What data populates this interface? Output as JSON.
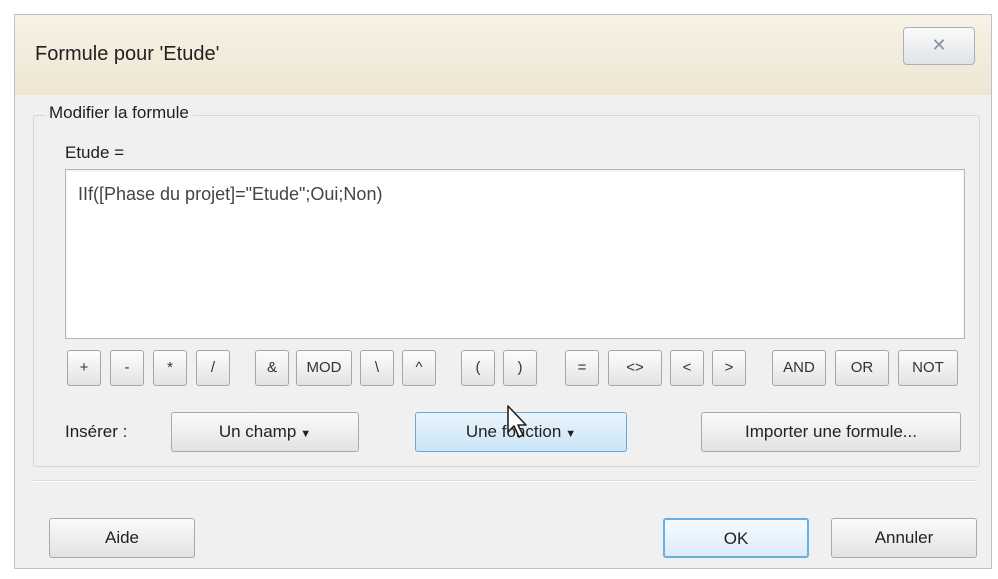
{
  "window": {
    "title": "Formule pour 'Etude'",
    "close_glyph": "✕"
  },
  "group": {
    "legend": "Modifier la formule",
    "formula_label": "Etude =",
    "formula_text": "IIf([Phase du projet]=\"Etude\";Oui;Non)"
  },
  "operators": [
    "+",
    "-",
    "*",
    "/",
    "&",
    "MOD",
    "\\",
    "^",
    "(",
    ")",
    "=",
    "<>",
    "<",
    ">",
    "AND",
    "OR",
    "NOT"
  ],
  "insert": {
    "label": "Insérer :",
    "field_button": "Un champ",
    "function_button": "Une fonction",
    "import_button": "Importer une formule..."
  },
  "footer": {
    "help_button": "Aide",
    "ok_button": "OK",
    "cancel_button": "Annuler"
  },
  "icons": {
    "close": "close-icon",
    "dropdown": "chevron-down-icon",
    "cursor": "mouse-pointer-icon"
  },
  "colors": {
    "hover_accent": "#6aa6d8",
    "default_button_border": "#66b0e6"
  }
}
